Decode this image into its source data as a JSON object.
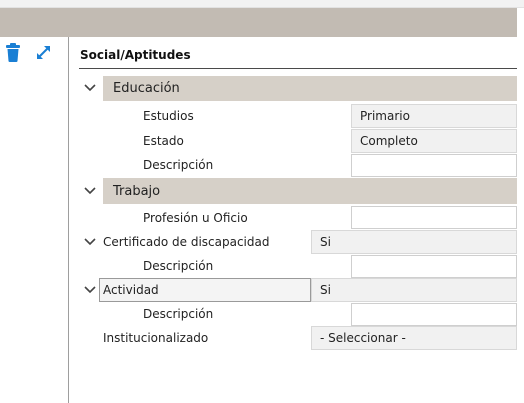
{
  "toolbar": {
    "delete_icon": "trash-icon",
    "expand_icon": "expand-icon"
  },
  "section": {
    "title": "Social/Aptitudes"
  },
  "groups": {
    "educacion": {
      "title": "Educación"
    },
    "trabajo": {
      "title": "Trabajo"
    }
  },
  "fields": {
    "estudios": {
      "label": "Estudios",
      "value": "Primario"
    },
    "estado": {
      "label": "Estado",
      "value": "Completo"
    },
    "descripcion_edu": {
      "label": "Descripción",
      "value": ""
    },
    "profesion": {
      "label": "Profesión u Oficio",
      "value": ""
    },
    "discapacidad": {
      "label": "Certificado de discapacidad",
      "value": "Si"
    },
    "descripcion_disc": {
      "label": "Descripción",
      "value": ""
    },
    "actividad": {
      "label": "Actividad",
      "value": "Si"
    },
    "descripcion_act": {
      "label": "Descripción",
      "value": ""
    },
    "institucionalizado": {
      "label": "Institucionalizado",
      "value": "- Seleccionar -"
    }
  },
  "colors": {
    "title_bar": "#c2bbb3",
    "group_band": "#d6d0c8",
    "icon_blue": "#1a7fd4"
  }
}
